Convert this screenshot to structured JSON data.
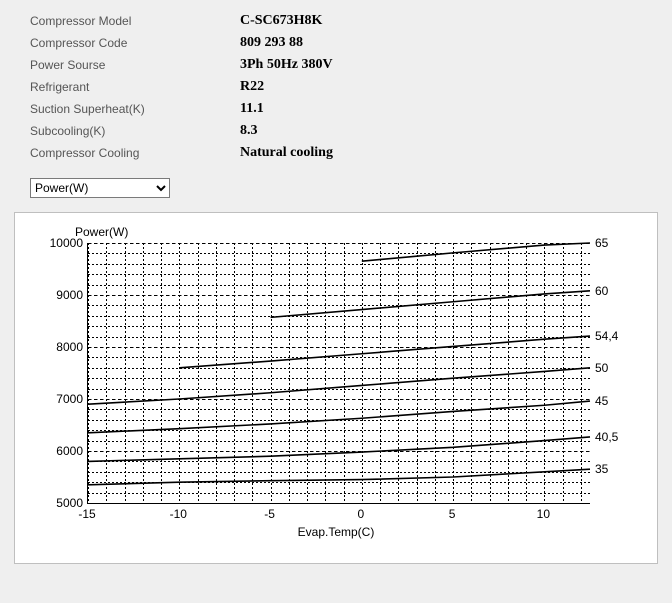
{
  "specs": {
    "rows": [
      {
        "label": "Compressor Model",
        "value": "C-SC673H8K"
      },
      {
        "label": "Compressor Code",
        "value": "809 293 88"
      },
      {
        "label": "Power Sourse",
        "value": "3Ph  50Hz  380V"
      },
      {
        "label": "Refrigerant",
        "value": "R22"
      },
      {
        "label": "Suction Superheat(K)",
        "value": "11.1"
      },
      {
        "label": "Subcooling(K)",
        "value": "8.3"
      },
      {
        "label": "Compressor Cooling",
        "value": "Natural cooling"
      }
    ]
  },
  "dropdown": {
    "selected": "Power(W)"
  },
  "chart_data": {
    "type": "line",
    "title": "Power(W)",
    "xlabel": "Evap.Temp(C)",
    "ylabel": "Power(W)",
    "xlim": [
      -15,
      12.5
    ],
    "ylim": [
      5000,
      10000
    ],
    "yticks": [
      5000,
      6000,
      7000,
      8000,
      9000,
      10000
    ],
    "xticks": [
      -15,
      -10,
      -5,
      0,
      5,
      10
    ],
    "series": [
      {
        "name": "35",
        "x": [
          -15,
          -10,
          -5,
          0,
          5,
          10,
          12.5
        ],
        "y": [
          5350,
          5400,
          5430,
          5450,
          5500,
          5600,
          5650
        ]
      },
      {
        "name": "40,5",
        "x": [
          -15,
          -10,
          -5,
          0,
          5,
          10,
          12.5
        ],
        "y": [
          5800,
          5850,
          5900,
          5980,
          6070,
          6200,
          6270
        ]
      },
      {
        "name": "45",
        "x": [
          -15,
          -10,
          -5,
          0,
          5,
          10,
          12.5
        ],
        "y": [
          6350,
          6430,
          6520,
          6630,
          6760,
          6880,
          6960
        ]
      },
      {
        "name": "50",
        "x": [
          -15,
          -10,
          -5,
          0,
          5,
          10,
          12.5
        ],
        "y": [
          6900,
          7000,
          7120,
          7260,
          7400,
          7530,
          7600
        ]
      },
      {
        "name": "54,4",
        "x": [
          -10,
          -5,
          0,
          5,
          10,
          12.5
        ],
        "y": [
          7600,
          7730,
          7870,
          8010,
          8150,
          8210
        ]
      },
      {
        "name": "60",
        "x": [
          -5,
          0,
          5,
          10,
          12.5
        ],
        "y": [
          8570,
          8720,
          8870,
          9020,
          9080
        ]
      },
      {
        "name": "65",
        "x": [
          0,
          5,
          10,
          12.5
        ],
        "y": [
          9650,
          9810,
          9960,
          10000
        ]
      }
    ]
  }
}
